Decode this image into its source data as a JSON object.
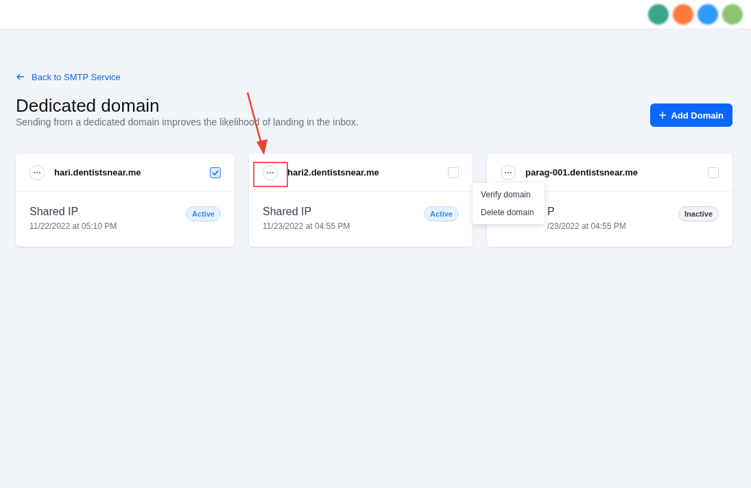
{
  "header": {
    "avatars": [
      {
        "color": "#3aa58c"
      },
      {
        "color": "#ff7a3d"
      },
      {
        "color": "#2b9bff"
      },
      {
        "color": "#8cc46f"
      }
    ]
  },
  "back_link": "Back to SMTP Service",
  "title": "Dedicated domain",
  "subtitle": "Sending from a dedicated domain improves the likelihood of landing in the inbox.",
  "add_button": "Add Domain",
  "cards": [
    {
      "domain": "hari.dentistsnear.me",
      "checked": true,
      "name": "Shared IP",
      "date": "11/22/2022 at 05:10 PM",
      "status": "Active",
      "active": true,
      "covered": false
    },
    {
      "domain": "hari2.dentistsnear.me",
      "checked": false,
      "name": "Shared IP",
      "date": "11/23/2022 at 04:55 PM",
      "status": "Active",
      "active": true,
      "covered": false
    },
    {
      "domain": "parag-001.dentistsnear.me",
      "checked": false,
      "name": "P",
      "date": "/23/2022 at 04:55 PM",
      "status": "Inactive",
      "active": false,
      "covered": true
    }
  ],
  "menu": {
    "items": [
      "Verify domain",
      "Delete domain"
    ]
  }
}
